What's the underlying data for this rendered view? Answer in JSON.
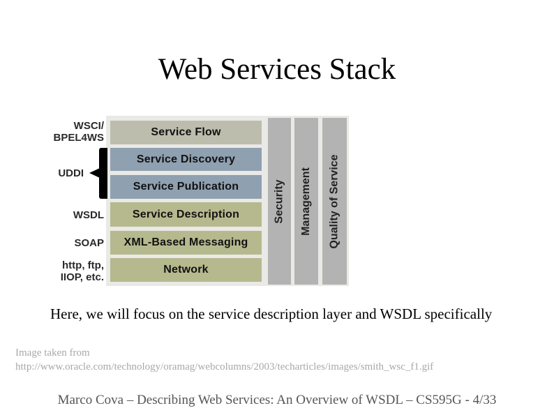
{
  "slide": {
    "title": "Web Services Stack",
    "body_text": "Here, we will focus on the service description layer and WSDL specifically",
    "credit_line1": "Image taken from",
    "credit_line2": "http://www.oracle.com/technology/oramag/webcolumns/2003/techarticles/images/smith_wsc_f1.gif",
    "footer": "Marco Cova – Describing Web Services: An Overview of WSDL – CS595G -  4/33"
  },
  "diagram": {
    "layers": [
      {
        "label": "Service Flow",
        "color": "#bdbdad"
      },
      {
        "label": "Service Discovery",
        "color": "#8fa0b1"
      },
      {
        "label": "Service Publication",
        "color": "#8fa0b1"
      },
      {
        "label": "Service Description",
        "color": "#b6b98d"
      },
      {
        "label": "XML-Based Messaging",
        "color": "#b6b98d"
      },
      {
        "label": "Network",
        "color": "#b6b98d"
      }
    ],
    "side_labels": [
      {
        "text": "WSCI/\nBPEL4WS"
      },
      {
        "text": "UDDI"
      },
      {
        "text": "WSDL"
      },
      {
        "text": "SOAP"
      },
      {
        "text": "http, ftp,\nIIOP, etc."
      }
    ],
    "vertical_bars": [
      {
        "label": "Security"
      },
      {
        "label": "Management"
      },
      {
        "label": "Quality of Service"
      }
    ],
    "bar_color": "#b3b3b3"
  }
}
